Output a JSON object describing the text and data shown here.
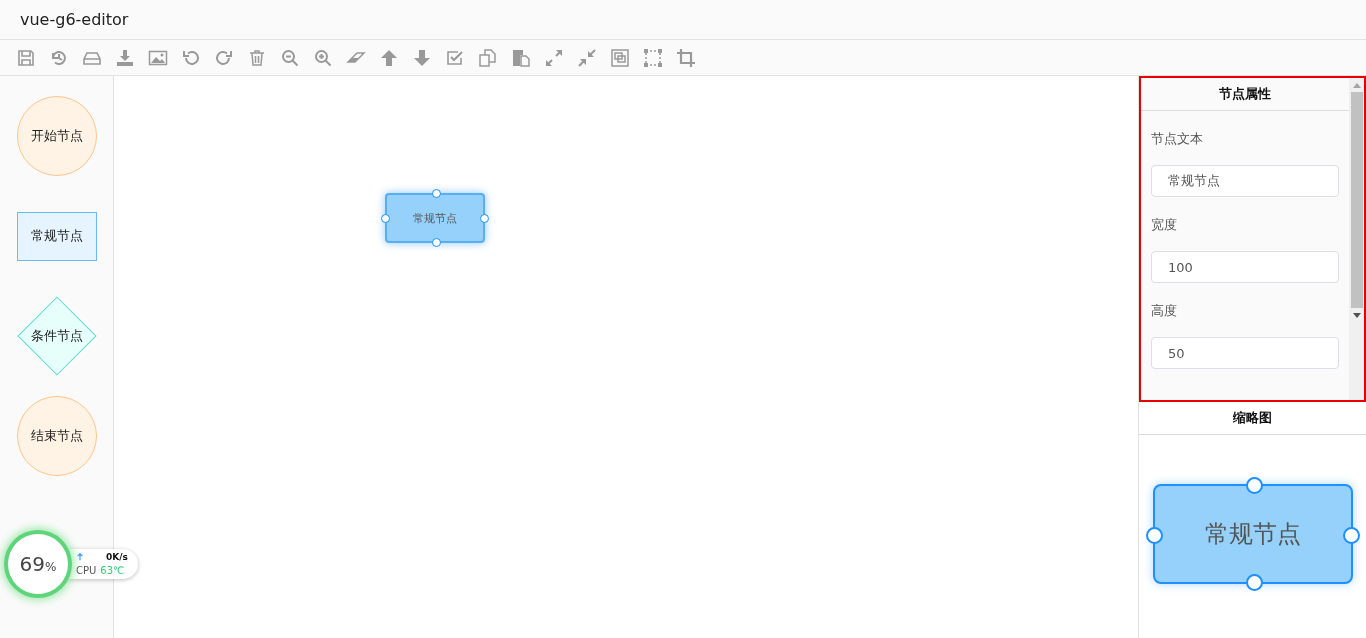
{
  "header": {
    "title": "vue-g6-editor"
  },
  "palette": [
    {
      "kind": "circle",
      "label": "开始节点"
    },
    {
      "kind": "rect",
      "label": "常规节点"
    },
    {
      "kind": "diamond",
      "label": "条件节点"
    },
    {
      "kind": "circle",
      "label": "结束节点"
    }
  ],
  "canvas": {
    "node": {
      "label": "常规节点",
      "selected": true
    }
  },
  "properties": {
    "title": "节点属性",
    "highlighted": true,
    "fields": [
      {
        "label": "节点文本",
        "value": "常规节点"
      },
      {
        "label": "宽度",
        "value": "100"
      },
      {
        "label": "高度",
        "value": "50"
      }
    ]
  },
  "minimap": {
    "title": "缩略图",
    "node": {
      "label": "常规节点",
      "selected": true
    }
  },
  "monitor": {
    "percent": "69",
    "unit": "%",
    "speed": "0K/s",
    "cpu_label": "CPU",
    "cpu_temp": "63℃"
  }
}
